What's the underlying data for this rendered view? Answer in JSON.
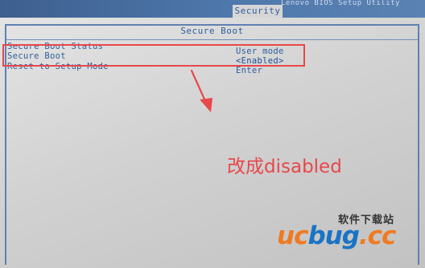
{
  "header": {
    "active_tab": "Security",
    "utility_title": "Lenovo BIOS Setup Utility"
  },
  "page": {
    "title": "Secure Boot"
  },
  "settings": [
    {
      "label": "Secure Boot Status",
      "value": "User mode"
    },
    {
      "label": "Secure Boot",
      "value": "<Enabled>"
    },
    {
      "label": "Reset to Setup Mode",
      "value": "Enter"
    }
  ],
  "annotation": {
    "note": "改成disabled",
    "highlight_color": "#e8474b"
  },
  "watermark": {
    "site_name_cn": "软件下载站",
    "logo_part1": "uc",
    "logo_part2": "bug",
    "logo_part3": ".cc"
  },
  "colors": {
    "bios_blue": "#2f5e9c",
    "top_bar": "#4f78ac",
    "logo_orange": "#f07a22",
    "logo_blue": "#1a74c4"
  }
}
